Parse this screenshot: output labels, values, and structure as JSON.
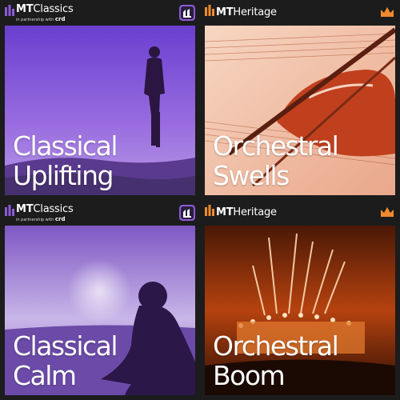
{
  "tiles": [
    {
      "brand": {
        "prefix": "MT",
        "name": "Classics"
      },
      "partner": {
        "text": "in partnership with",
        "mark": "crd"
      },
      "badge_icon": "classics-badge-icon",
      "title": "Classical\nUplifting",
      "theme": "purple"
    },
    {
      "brand": {
        "prefix": "MT",
        "name": "Heritage"
      },
      "badge_icon": "crown-icon",
      "title": "Orchestral\nSwells",
      "theme": "orange"
    },
    {
      "brand": {
        "prefix": "MT",
        "name": "Classics"
      },
      "partner": {
        "text": "in partnership with",
        "mark": "crd"
      },
      "badge_icon": "classics-badge-icon",
      "title": "Classical\nCalm",
      "theme": "purple"
    },
    {
      "brand": {
        "prefix": "MT",
        "name": "Heritage"
      },
      "badge_icon": "crown-icon",
      "title": "Orchestral\nBoom",
      "theme": "orange"
    }
  ],
  "colors": {
    "purple": "#8a5bd6",
    "orange": "#f08a2c",
    "background": "#1c1c1c"
  }
}
